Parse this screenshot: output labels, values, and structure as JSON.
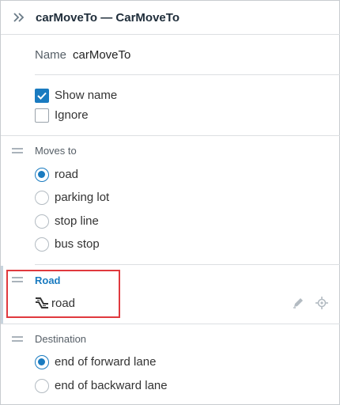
{
  "header": {
    "title": "carMoveTo — CarMoveTo",
    "collapse_icon": "double-chevron-right-icon"
  },
  "name_row": {
    "label": "Name",
    "value": "carMoveTo"
  },
  "flags": [
    {
      "label": "Show name",
      "checked": true
    },
    {
      "label": "Ignore",
      "checked": false
    }
  ],
  "moves_to": {
    "label": "Moves to",
    "options": [
      {
        "label": "road",
        "selected": true
      },
      {
        "label": "parking lot",
        "selected": false
      },
      {
        "label": "stop line",
        "selected": false
      },
      {
        "label": "bus stop",
        "selected": false
      }
    ]
  },
  "road": {
    "label": "Road",
    "value": "road",
    "icon": "road-icon",
    "actions": [
      "edit-icon",
      "locate-icon"
    ],
    "highlight_color": "#e0393e"
  },
  "destination": {
    "label": "Destination",
    "options": [
      {
        "label": "end of forward lane",
        "selected": true
      },
      {
        "label": "end of backward lane",
        "selected": false
      }
    ]
  },
  "colors": {
    "accent": "#1a7bc0",
    "title": "#1f2d3a",
    "divider": "#dcdfe2"
  }
}
